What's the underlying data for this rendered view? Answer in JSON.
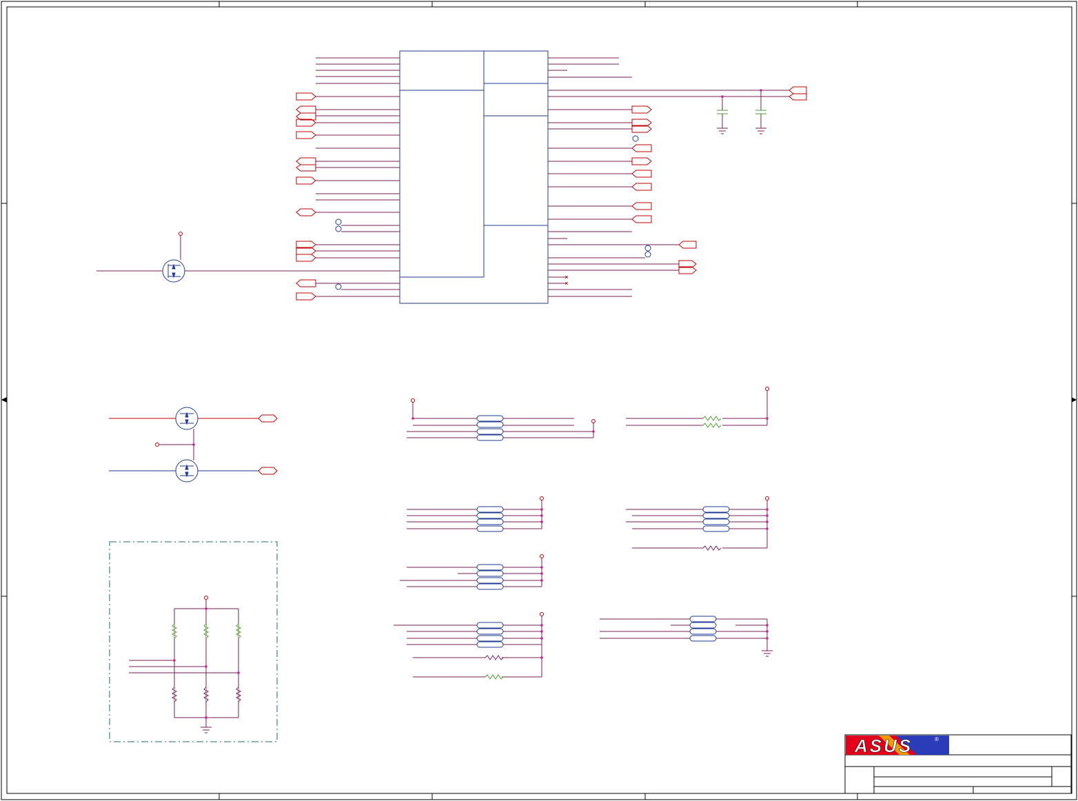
{
  "sheet": {
    "brand_logo_text": "ASUS",
    "registered_mark": "®",
    "colors": {
      "frame": "#000000",
      "wire_red": "#c00000",
      "wire_blue": "#1f3a93",
      "net_purple": "#7a1e5a",
      "junction_magenta": "#c020a0",
      "resistor_green": "#4aa02c",
      "dashed_box": "#1a6b6b",
      "logo_red": "#e3001b",
      "logo_blue": "#2a3cb8"
    },
    "icons": [
      "mosfet-icon",
      "ground-icon",
      "capacitor-icon",
      "resistor-icon",
      "resistor-array-icon",
      "power-rail-icon",
      "connector-port-icon",
      "test-point-icon"
    ]
  }
}
